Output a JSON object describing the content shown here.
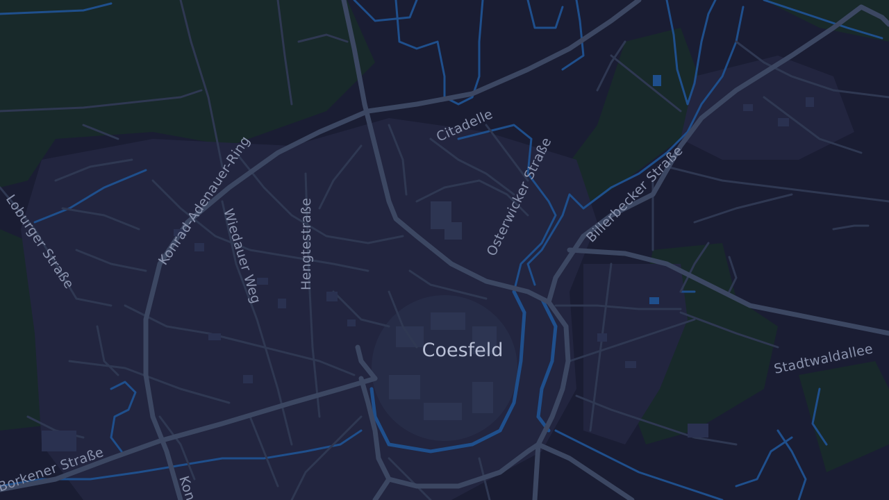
{
  "map": {
    "city": "Coesfeld",
    "streets": [
      "Citadelle",
      "Konrad-Adenauer-Ring",
      "Hengtestraße",
      "Wiedauer Weg",
      "Loburger Straße",
      "Osterwicker Straße",
      "Billerbecker Straße",
      "Stadtwaldallee",
      "Borkener Straße",
      "Kon"
    ],
    "colors": {
      "background": "#1a1d33",
      "forest": "#18292a",
      "urban": "#22253f",
      "water": "#1f4f8c",
      "major_road": "#3c4762",
      "minor_road": "#2f3852",
      "label": "#8a93ad"
    }
  }
}
